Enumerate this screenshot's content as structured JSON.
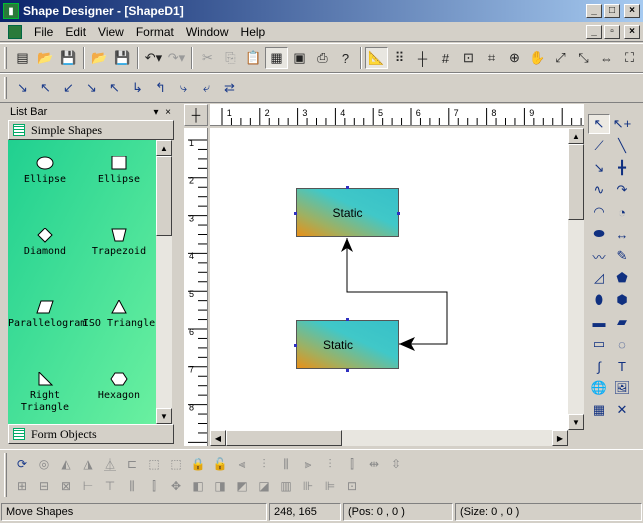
{
  "window": {
    "title": "Shape Designer - [ShapeD1]",
    "min_glyph": "_",
    "max_glyph": "□",
    "close_glyph": "×",
    "restore_glyph": "▫"
  },
  "menu": [
    "File",
    "Edit",
    "View",
    "Format",
    "Window",
    "Help"
  ],
  "toolbar1": {
    "groups": [
      [
        {
          "icon": "new-icon",
          "glyph": "▤"
        },
        {
          "icon": "open-icon",
          "glyph": "📂"
        },
        {
          "icon": "save-icon",
          "glyph": "💾"
        }
      ],
      [
        {
          "icon": "open-template-icon",
          "glyph": "📂"
        },
        {
          "icon": "save-template-icon",
          "glyph": "💾"
        }
      ],
      [
        {
          "icon": "undo-icon",
          "glyph": "↶▾"
        },
        {
          "icon": "redo-icon",
          "glyph": "↷▾",
          "disabled": true
        }
      ],
      [
        {
          "icon": "cut-icon",
          "glyph": "✂",
          "disabled": true
        },
        {
          "icon": "copy-icon",
          "glyph": "⎘",
          "disabled": true
        },
        {
          "icon": "paste-icon",
          "glyph": "📋"
        },
        {
          "icon": "properties-icon",
          "glyph": "▦",
          "pressed": true
        },
        {
          "icon": "layout-icon",
          "glyph": "▣"
        },
        {
          "icon": "print-icon",
          "glyph": "⎙"
        },
        {
          "icon": "help-icon",
          "glyph": "?"
        }
      ],
      [
        {
          "icon": "ruler-icon",
          "glyph": "📐",
          "pressed": true
        },
        {
          "icon": "grid-icon",
          "glyph": "⠿"
        },
        {
          "icon": "snap-icon",
          "glyph": "┼"
        },
        {
          "icon": "guides-icon",
          "glyph": "#"
        },
        {
          "icon": "bounds-icon",
          "glyph": "⊡"
        },
        {
          "icon": "crop-icon",
          "glyph": "⌗"
        },
        {
          "icon": "zoom-icon",
          "glyph": "⊕"
        },
        {
          "icon": "pan-icon",
          "glyph": "✋"
        },
        {
          "icon": "zoom-extent-icon",
          "glyph": "⤢"
        },
        {
          "icon": "zoom-selection-icon",
          "glyph": "⤡"
        },
        {
          "icon": "zoom-width-icon",
          "glyph": "⇔"
        },
        {
          "icon": "zoom-page-icon",
          "glyph": "⛶"
        }
      ]
    ]
  },
  "toolbar2": {
    "buttons": [
      {
        "icon": "connector-1-icon",
        "glyph": "↘"
      },
      {
        "icon": "connector-2-icon",
        "glyph": "↖"
      },
      {
        "icon": "connector-3-icon",
        "glyph": "↙"
      },
      {
        "icon": "connector-4-icon",
        "glyph": "↘"
      },
      {
        "icon": "connector-5-icon",
        "glyph": "↖"
      },
      {
        "icon": "connector-6-icon",
        "glyph": "↳"
      },
      {
        "icon": "connector-7-icon",
        "glyph": "↰"
      },
      {
        "icon": "connector-8-icon",
        "glyph": "⤷"
      },
      {
        "icon": "connector-9-icon",
        "glyph": "⤶"
      },
      {
        "icon": "connector-10-icon",
        "glyph": "⇄"
      }
    ]
  },
  "listbar": {
    "title": "List Bar",
    "pin_glyph": "▾",
    "close_glyph": "×",
    "group1": "Simple Shapes",
    "group2": "Form Objects",
    "up_glyph": "▲",
    "down_glyph": "▼",
    "shapes": [
      {
        "label": "Ellipse",
        "kind": "ellipse"
      },
      {
        "label": "Ellipse",
        "kind": "square"
      },
      {
        "label": "Diamond",
        "kind": "diamond"
      },
      {
        "label": "Trapezoid",
        "kind": "trapezoid"
      },
      {
        "label": "Parallelogram",
        "kind": "parallelogram"
      },
      {
        "label": "ISO Triangle",
        "kind": "triangle"
      },
      {
        "label": "Right Triangle",
        "kind": "right-triangle"
      },
      {
        "label": "Hexagon",
        "kind": "hexagon"
      }
    ]
  },
  "editor": {
    "corner_glyph": "┼",
    "hruler_labels": [
      "1",
      "2",
      "3",
      "4",
      "5",
      "6",
      "7",
      "8",
      "9"
    ],
    "vruler_labels": [
      "1",
      "2",
      "3",
      "4",
      "5",
      "6",
      "7",
      "8"
    ],
    "shapes": [
      {
        "label": "Static"
      },
      {
        "label": "Static"
      }
    ],
    "scroll_up": "▲",
    "scroll_down": "▼",
    "scroll_left": "◀",
    "scroll_right": "▶"
  },
  "toolbox": {
    "tools": [
      {
        "icon": "pointer-icon",
        "glyph": "↖",
        "selected": true
      },
      {
        "icon": "rotate-pointer-icon",
        "glyph": "↖+"
      },
      {
        "icon": "polyline-icon",
        "glyph": "⟋"
      },
      {
        "icon": "line-icon",
        "glyph": "╲"
      },
      {
        "icon": "arrow-line-icon",
        "glyph": "↘"
      },
      {
        "icon": "cross-line-icon",
        "glyph": "╋"
      },
      {
        "icon": "bezier-icon",
        "glyph": "∿"
      },
      {
        "icon": "curve-arrow-icon",
        "glyph": "↷"
      },
      {
        "icon": "arc-icon",
        "glyph": "◠"
      },
      {
        "icon": "pie-icon",
        "glyph": "◔"
      },
      {
        "icon": "blob-icon",
        "glyph": "⬬"
      },
      {
        "icon": "dimension-icon",
        "glyph": "↔"
      },
      {
        "icon": "freehand-icon",
        "glyph": "〰"
      },
      {
        "icon": "pen-icon",
        "glyph": "✎"
      },
      {
        "icon": "closed-curve-icon",
        "glyph": "◿"
      },
      {
        "icon": "pentagon-arrow-icon",
        "glyph": "⬟"
      },
      {
        "icon": "ellipse-tool-icon",
        "glyph": "⬮"
      },
      {
        "icon": "hexagon-tool-icon",
        "glyph": "⬢"
      },
      {
        "icon": "rectangle-tool-icon",
        "glyph": "▬"
      },
      {
        "icon": "parallelogram-tool-icon",
        "glyph": "▰"
      },
      {
        "icon": "rounded-rect-tool-icon",
        "glyph": "▭"
      },
      {
        "icon": "closed-bezier-icon",
        "glyph": "◌"
      },
      {
        "icon": "spline-icon",
        "glyph": "∫"
      },
      {
        "icon": "text-tool-icon",
        "glyph": "T"
      },
      {
        "icon": "image-tool-icon",
        "glyph": "🌐"
      },
      {
        "icon": "picture-tool-icon",
        "glyph": "🖼"
      },
      {
        "icon": "table-tool-icon",
        "glyph": "▦"
      },
      {
        "icon": "delete-tool-icon",
        "glyph": "✕"
      }
    ]
  },
  "bottom_toolbar": {
    "row1": [
      {
        "icon": "rotate-icon",
        "glyph": "⟳",
        "active": true
      },
      {
        "icon": "rotate-free-icon",
        "glyph": "◎"
      },
      {
        "icon": "flip-left-icon",
        "glyph": "◭"
      },
      {
        "icon": "flip-right-icon",
        "glyph": "◮"
      },
      {
        "icon": "mirror-icon",
        "glyph": "⏅"
      },
      {
        "icon": "align-edge-icon",
        "glyph": "⊏"
      },
      {
        "icon": "group-icon",
        "glyph": "⬚"
      },
      {
        "icon": "ungroup-icon",
        "glyph": "⬚"
      },
      {
        "icon": "lock-icon",
        "glyph": "🔒"
      },
      {
        "icon": "unlock-icon",
        "glyph": "🔓"
      },
      {
        "icon": "align-left-icon",
        "glyph": "⫷"
      },
      {
        "icon": "align-top-icon",
        "glyph": "⫶"
      },
      {
        "icon": "align-center-icon",
        "glyph": "⫼"
      },
      {
        "icon": "align-right-icon",
        "glyph": "⫸"
      },
      {
        "icon": "align-bottom-icon",
        "glyph": "⫶"
      },
      {
        "icon": "align-middle-icon",
        "glyph": "⫿"
      },
      {
        "icon": "space-h-icon",
        "glyph": "⇹"
      },
      {
        "icon": "space-v-icon",
        "glyph": "⇳"
      }
    ],
    "row2": [
      {
        "icon": "same-size-icon",
        "glyph": "⊞"
      },
      {
        "icon": "same-width-icon",
        "glyph": "⊟"
      },
      {
        "icon": "same-height-icon",
        "glyph": "⊠"
      },
      {
        "icon": "center-h-icon",
        "glyph": "⊢"
      },
      {
        "icon": "center-v-icon",
        "glyph": "⊤"
      },
      {
        "icon": "distribute-h-icon",
        "glyph": "⫼"
      },
      {
        "icon": "distribute-v-icon",
        "glyph": "⫿"
      },
      {
        "icon": "nudge-icon",
        "glyph": "✥"
      },
      {
        "icon": "bring-front-icon",
        "glyph": "◧"
      },
      {
        "icon": "send-back-icon",
        "glyph": "◨"
      },
      {
        "icon": "forward-icon",
        "glyph": "◩"
      },
      {
        "icon": "backward-icon",
        "glyph": "◪"
      },
      {
        "icon": "order-icon",
        "glyph": "▥"
      },
      {
        "icon": "spacing-icon",
        "glyph": "⊪"
      },
      {
        "icon": "spacing-v-icon",
        "glyph": "⊫"
      },
      {
        "icon": "fit-icon",
        "glyph": "⊡"
      }
    ]
  },
  "status": {
    "message": "Move Shapes",
    "coords": "248, 165",
    "pos": "(Pos: 0 , 0 )",
    "size": "(Size: 0 , 0 )"
  }
}
